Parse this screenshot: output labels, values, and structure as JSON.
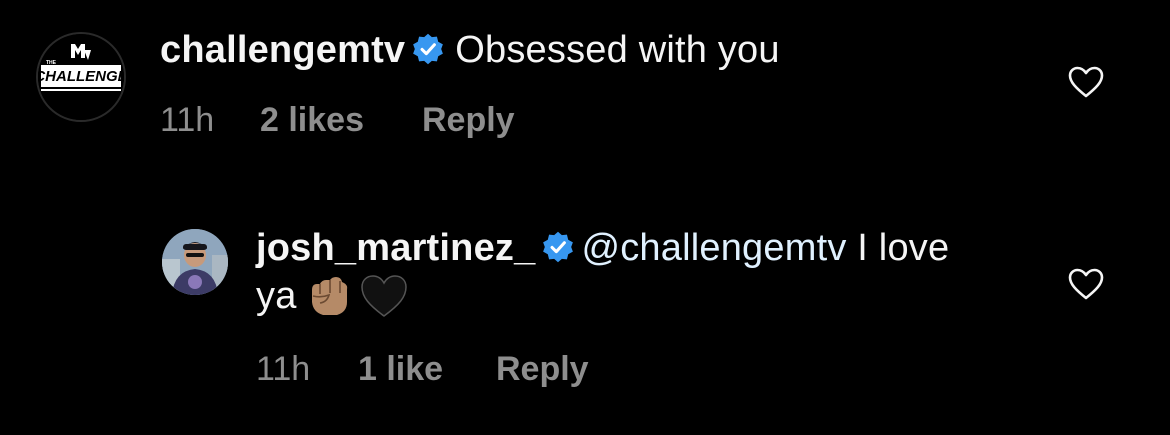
{
  "comments": [
    {
      "username": "challengemtv",
      "verified": true,
      "text": "Obsessed with you",
      "avatar": {
        "logo_text": "THE CHALLENGE",
        "logo_mark": "MTV"
      },
      "time": "11h",
      "likes": "2 likes",
      "reply_label": "Reply"
    }
  ],
  "replies": [
    {
      "username": "josh_martinez_",
      "verified": true,
      "mention": "@challengemtv",
      "text_after_mention": " I love ya",
      "emojis": [
        "raised-fist-medium-skin-tone",
        "black-heart"
      ],
      "time": "11h",
      "likes": "1 like",
      "reply_label": "Reply"
    }
  ],
  "colors": {
    "background": "#000000",
    "text": "#f5f5f5",
    "meta": "#8e8e8e",
    "verified_badge": "#3797f0",
    "mention": "#e0f1ff"
  },
  "icons": {
    "verified": "verified-badge-icon",
    "like": "heart-outline-icon"
  }
}
